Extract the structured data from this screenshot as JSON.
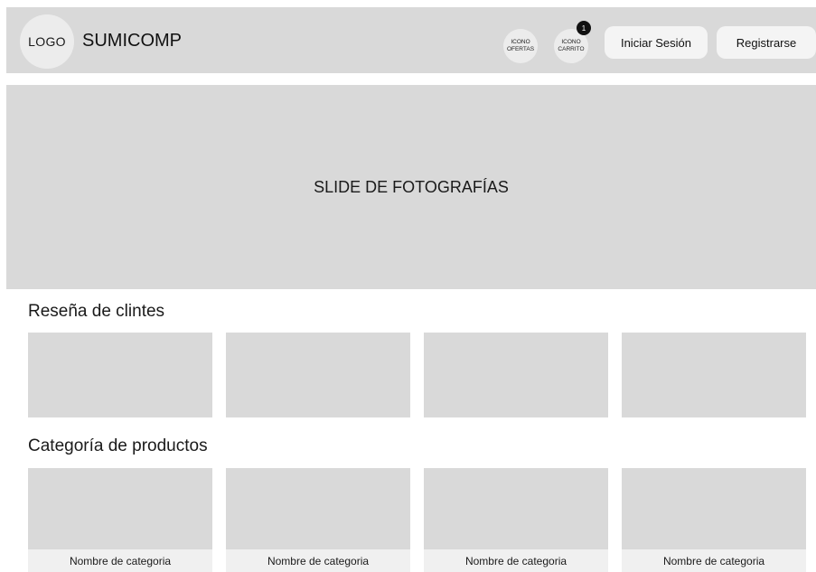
{
  "header": {
    "logo_text": "LOGO",
    "brand_name": "SUMICOMP",
    "ofertas_icon_label": "ICONO OFERTAS",
    "carrito_icon_label": "ICONO CARRITO",
    "cart_count": "1",
    "login_label": "Iniciar Sesión",
    "register_label": "Registrarse"
  },
  "hero": {
    "label": "SLIDE DE FOTOGRAFÍAS"
  },
  "reviews": {
    "title": "Reseña de clintes",
    "count": 4
  },
  "categories": {
    "title": "Categoría de productos",
    "items": [
      {
        "label": "Nombre de categoria"
      },
      {
        "label": "Nombre de categoria"
      },
      {
        "label": "Nombre de categoria"
      },
      {
        "label": "Nombre de categoria"
      }
    ]
  },
  "colors": {
    "placeholder_gray": "#d9d9d9",
    "light_gray": "#ececec",
    "badge": "#111111"
  }
}
